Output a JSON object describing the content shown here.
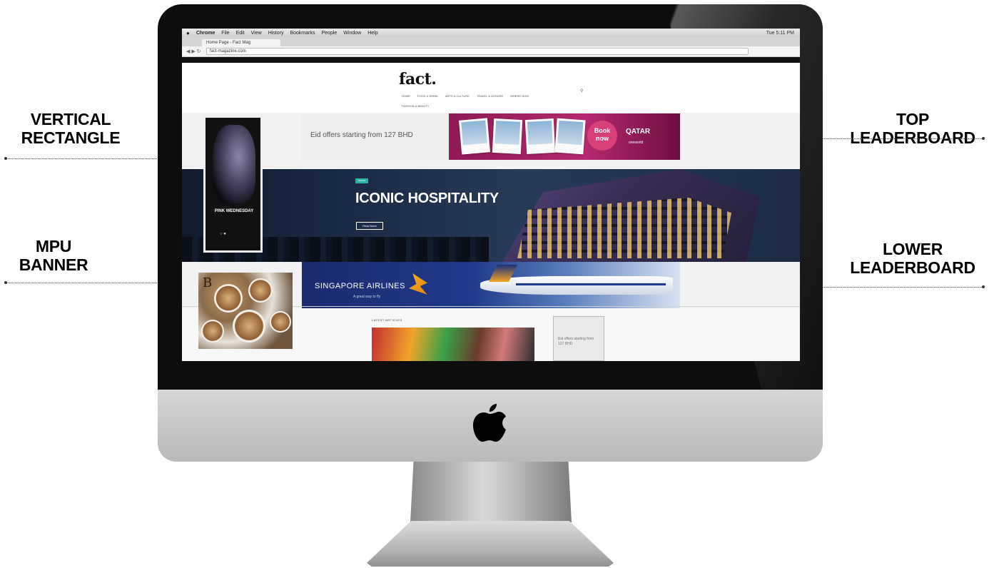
{
  "callouts": {
    "vertical_rectangle": [
      "VERTICAL",
      "RECTANGLE"
    ],
    "mpu_banner": [
      "MPU",
      "BANNER"
    ],
    "top_leaderboard": [
      "TOP",
      "LEADERBOARD"
    ],
    "lower_leaderboard": [
      "LOWER",
      "LEADERBOARD"
    ]
  },
  "browser": {
    "menubar": [
      "Chrome",
      "File",
      "Edit",
      "View",
      "History",
      "Bookmarks",
      "People",
      "Window",
      "Help"
    ],
    "menubar_right": "Tue 5:11 PM",
    "tab_title": "Home Page - Fact Mag",
    "url": "fact-magazine.com"
  },
  "site": {
    "logo": "fact.",
    "nav": [
      "HOME",
      "FOOD & DRINK",
      "ARTS & CULTURE",
      "TRAVEL & LEISURE",
      "WHERE NOW"
    ],
    "nav_second": "FASHION & BEAUTY",
    "search_icon": "search-icon"
  },
  "ad_top": {
    "text": "Eid offers starting from 127 BHD",
    "cta": "Book now",
    "brand": "QATAR",
    "brand_sub": "oneworld"
  },
  "hero": {
    "tag": "TRAVEL",
    "title": "ICONIC HOSPITALITY",
    "button": "Read More"
  },
  "ad_vertical": {
    "title": "PINK WEDNESDAY"
  },
  "ad_lower": {
    "brand": "SINGAPORE AIRLINES",
    "tagline": "A great way to fly"
  },
  "ad_mpu": {
    "letter": "B"
  },
  "articles": {
    "heading": "LATEST ARTICLES",
    "side_ad": "Eid offers starting from 127 BHD"
  },
  "colors": {
    "qatar_maroon": "#8e1a55",
    "singapore_blue": "#1c2a6e",
    "hero_navy": "#1c2c47",
    "tag_teal": "#2bb3a1"
  }
}
